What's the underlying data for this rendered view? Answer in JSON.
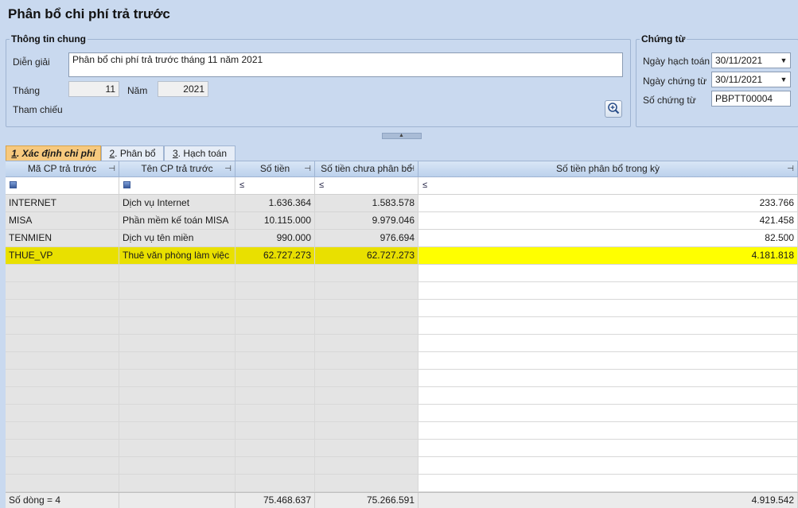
{
  "title": "Phân bổ chi phí trả trước",
  "general": {
    "legend": "Thông tin chung",
    "desc_label": "Diễn giải",
    "desc_value": "Phân bổ chi phí trả trước tháng 11 năm 2021",
    "month_label": "Tháng",
    "month_value": "11",
    "year_label": "Năm",
    "year_value": "2021",
    "ref_label": "Tham chiếu",
    "zoom_icon": "magnifier-plus-icon"
  },
  "voucher": {
    "legend": "Chứng từ",
    "posting_date_label": "Ngày hạch toán",
    "posting_date_value": "30/11/2021",
    "voucher_date_label": "Ngày chứng từ",
    "voucher_date_value": "30/11/2021",
    "voucher_no_label": "Số chứng từ",
    "voucher_no_value": "PBPTT00004"
  },
  "tabs": [
    {
      "key": "1",
      "label": ". Xác định chi phí"
    },
    {
      "key": "2",
      "label": ". Phân bổ"
    },
    {
      "key": "3",
      "label": ". Hạch toán"
    }
  ],
  "grid": {
    "columns": [
      "Mã CP trả trước",
      "Tên CP trả trước",
      "Số tiền",
      "Số tiền chưa phân bổ",
      "Số tiền phân bổ trong kỳ"
    ],
    "filter_ops": [
      "≤",
      "≤",
      "≤"
    ],
    "rows": [
      {
        "code": "INTERNET",
        "name": "Dịch vụ Internet",
        "amount": "1.636.364",
        "unallocated": "1.583.578",
        "allocated": "233.766"
      },
      {
        "code": "MISA",
        "name": "Phần mềm kế toán MISA",
        "amount": "10.115.000",
        "unallocated": "9.979.046",
        "allocated": "421.458"
      },
      {
        "code": "TENMIEN",
        "name": "Dịch vụ tên miền",
        "amount": "990.000",
        "unallocated": "976.694",
        "allocated": "82.500"
      },
      {
        "code": "THUE_VP",
        "name": "Thuê văn phòng làm việc",
        "amount": "62.727.273",
        "unallocated": "62.727.273",
        "allocated": "4.181.818"
      }
    ],
    "footer": {
      "row_count": "Số dòng = 4",
      "total_amount": "75.468.637",
      "total_unallocated": "75.266.591",
      "total_allocated": "4.919.542"
    }
  }
}
